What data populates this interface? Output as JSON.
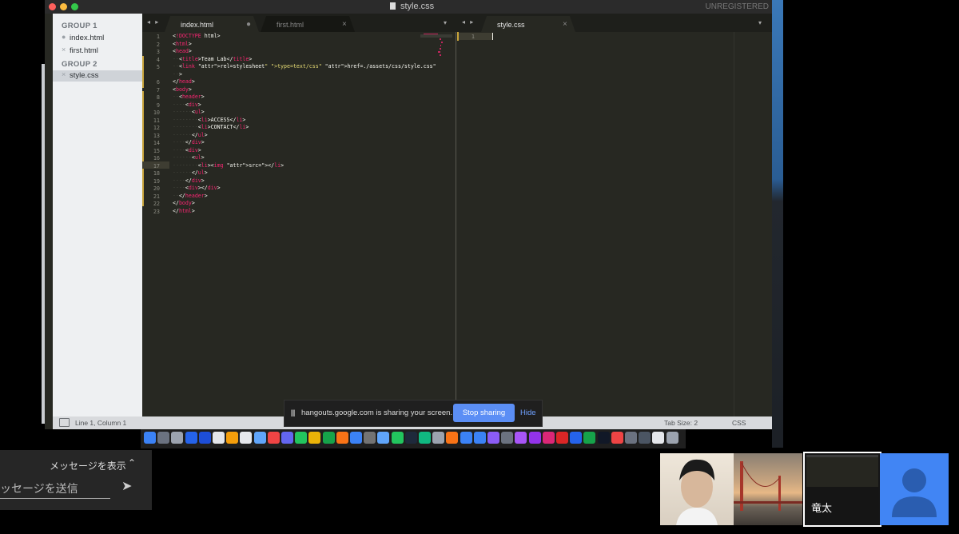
{
  "window": {
    "title": "style.css",
    "unregistered": "UNREGISTERED"
  },
  "sidebar": {
    "groups": [
      {
        "label": "GROUP 1",
        "files": [
          {
            "name": "index.html",
            "mark": "●"
          },
          {
            "name": "first.html",
            "mark": "×"
          }
        ]
      },
      {
        "label": "GROUP 2",
        "files": [
          {
            "name": "style.css",
            "mark": "×"
          }
        ]
      }
    ]
  },
  "tabs_left": [
    {
      "label": "index.html",
      "close": "●"
    },
    {
      "label": "first.html",
      "close": "×"
    }
  ],
  "tabs_right": [
    {
      "label": "style.css",
      "close": "×"
    }
  ],
  "nav_arrows": "◂ ▸",
  "dropdown_icon": "▾",
  "editor_left": {
    "line_numbers": [
      "1",
      "2",
      "3",
      "4",
      "5",
      "",
      "6",
      "7",
      "8",
      "9",
      "10",
      "11",
      "12",
      "13",
      "14",
      "15",
      "16",
      "17",
      "18",
      "19",
      "20",
      "21",
      "22",
      "23"
    ],
    "lines": [
      "<!DOCTYPE html>",
      "<html>",
      "<head>",
      "  <title>Team Lab</title>",
      "  <link rel=\"stylesheet\" type=\"text/css\" href=\"./assets/css/style.css\"",
      "  >",
      "</head>",
      "<body>",
      "  <header>",
      "    <div>",
      "      <ul>",
      "        <li>ACCESS</li>",
      "        <li>CONTACT</li>",
      "      </ul>",
      "    </div>",
      "    <div>",
      "      <ul>",
      "        <li><img src=\"\"></li>",
      "      </ul>",
      "    </div>",
      "    <div></div>",
      "  </header>",
      "</body>",
      "</html>"
    ]
  },
  "editor_right": {
    "line_numbers": [
      "1"
    ]
  },
  "statusbar": {
    "position": "Line 1, Column 1",
    "tab_size": "Tab Size: 2",
    "syntax": "CSS"
  },
  "share_bar": {
    "pause_icon": "||",
    "message": "hangouts.google.com is sharing your screen.",
    "stop": "Stop sharing",
    "hide": "Hide"
  },
  "chat": {
    "show_messages": "メッセージを表示",
    "caret": "⌃",
    "placeholder": "メッセージを送信",
    "send_icon": "➤"
  },
  "participants": [
    {
      "name": ""
    },
    {
      "name": ""
    },
    {
      "name": "竜太"
    },
    {
      "name": ""
    }
  ]
}
